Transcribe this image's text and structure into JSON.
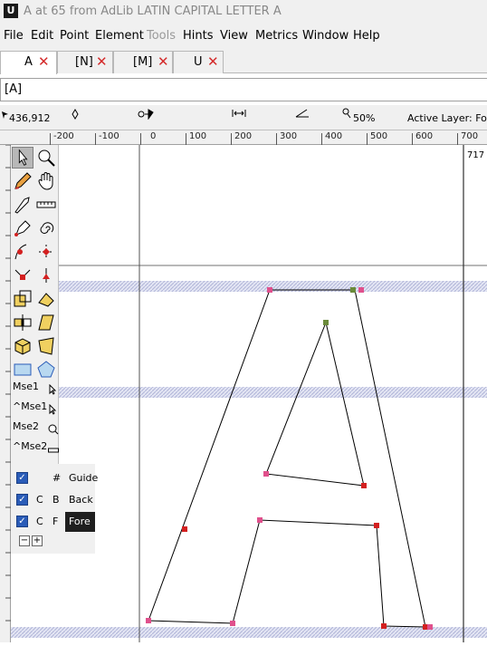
{
  "window": {
    "title": "A at 65 from AdLib LATIN CAPITAL LETTER A",
    "app_icon": "U"
  },
  "menu": [
    "File",
    "Edit",
    "Point",
    "Element",
    "Tools",
    "Hints",
    "View",
    "Metrics",
    "Window",
    "Help"
  ],
  "tabs": [
    {
      "label": "A"
    },
    {
      "label": "[N]"
    },
    {
      "label": "[M]"
    },
    {
      "label": "U"
    }
  ],
  "glyph_field": {
    "value": "[A]"
  },
  "info": {
    "coords": "436,912",
    "zoom": "50%",
    "active_layer": "Active Layer: Fore"
  },
  "ruler": {
    "labels": [
      "-200",
      "-100",
      "0",
      "100",
      "200",
      "300",
      "400",
      "500",
      "600",
      "700"
    ],
    "width_readout": "717"
  },
  "mouse_modes": [
    "Mse1",
    "^Mse1",
    "Mse2",
    "^Mse2"
  ],
  "layers": [
    {
      "c1": "",
      "c2": "#",
      "name": "Guide"
    },
    {
      "c1": "C",
      "c2": "B",
      "name": "Back"
    },
    {
      "c1": "C",
      "c2": "F",
      "name": "Fore"
    }
  ],
  "layer_buttons": {
    "remove": "−",
    "add": "+"
  },
  "icons": {
    "tab_close": "close-icon",
    "checkbox": "checkmark-icon"
  },
  "colors": {
    "outline": "#000000",
    "on_curve_point": "#e0508c",
    "corner_point": "#d32020",
    "selected_point": "#6a8a3a",
    "guide_band": "#c9cde8",
    "close_red": "#d42a2a",
    "checkbox_blue": "#2a5cb8"
  }
}
